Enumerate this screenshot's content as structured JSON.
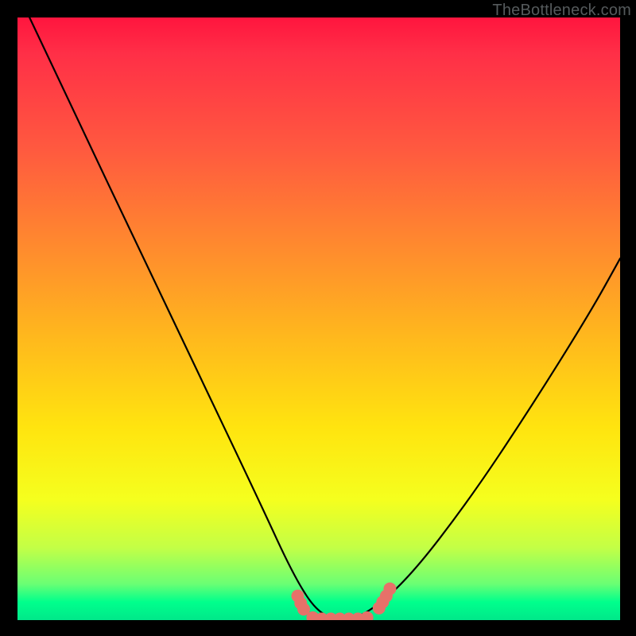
{
  "watermark": "TheBottleneck.com",
  "chart_data": {
    "type": "line",
    "title": "",
    "xlabel": "",
    "ylabel": "",
    "xlim": [
      0,
      100
    ],
    "ylim": [
      0,
      100
    ],
    "series": [
      {
        "name": "curve",
        "x": [
          2,
          10,
          20,
          30,
          40,
          46,
          50,
          54,
          58,
          65,
          75,
          85,
          95,
          100
        ],
        "y": [
          100,
          83,
          62,
          41,
          20,
          7,
          1,
          0,
          1,
          7,
          20,
          35,
          51,
          60
        ]
      }
    ],
    "markers": [
      {
        "name": "left-cluster-1",
        "x": 46.5,
        "y": 4.0
      },
      {
        "name": "left-cluster-2",
        "x": 47.0,
        "y": 2.8
      },
      {
        "name": "left-cluster-3",
        "x": 47.5,
        "y": 1.8
      },
      {
        "name": "bottom-1",
        "x": 49.0,
        "y": 0.4
      },
      {
        "name": "bottom-2",
        "x": 50.5,
        "y": 0.2
      },
      {
        "name": "bottom-3",
        "x": 52.0,
        "y": 0.2
      },
      {
        "name": "bottom-4",
        "x": 53.5,
        "y": 0.2
      },
      {
        "name": "bottom-5",
        "x": 55.0,
        "y": 0.2
      },
      {
        "name": "bottom-6",
        "x": 56.5,
        "y": 0.2
      },
      {
        "name": "bottom-7",
        "x": 58.0,
        "y": 0.4
      },
      {
        "name": "right-cluster-1",
        "x": 60.0,
        "y": 2.0
      },
      {
        "name": "right-cluster-2",
        "x": 60.6,
        "y": 3.0
      },
      {
        "name": "right-cluster-3",
        "x": 61.2,
        "y": 4.0
      },
      {
        "name": "right-cluster-4",
        "x": 61.8,
        "y": 5.2
      }
    ],
    "marker_color": "#e77169",
    "curve_color": "#000000",
    "background_gradient": [
      "#ff153e",
      "#ff5a3f",
      "#ffb51e",
      "#ffe40f",
      "#c3ff46",
      "#00ff8c"
    ]
  }
}
